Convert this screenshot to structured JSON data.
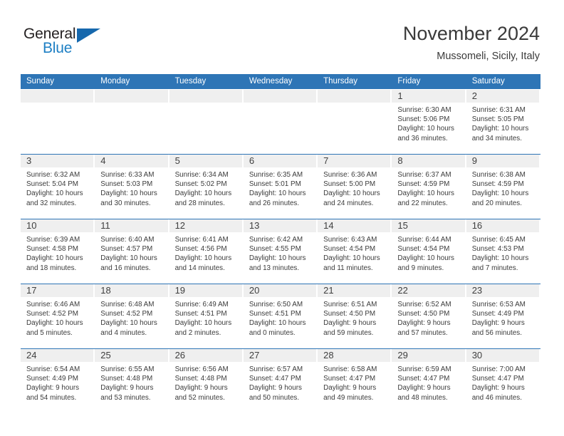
{
  "brand": {
    "name_part1": "General",
    "name_part2": "Blue",
    "accent_color": "#1668ad",
    "text_color": "#231f20"
  },
  "header": {
    "title": "November 2024",
    "location": "Mussomeli, Sicily, Italy"
  },
  "theme": {
    "header_blue": "#2e75b6",
    "daynum_band": "#efefef",
    "text": "#3b3b3b"
  },
  "weekdays": [
    "Sunday",
    "Monday",
    "Tuesday",
    "Wednesday",
    "Thursday",
    "Friday",
    "Saturday"
  ],
  "weeks": [
    [
      {
        "day": "",
        "empty": true
      },
      {
        "day": "",
        "empty": true
      },
      {
        "day": "",
        "empty": true
      },
      {
        "day": "",
        "empty": true
      },
      {
        "day": "",
        "empty": true
      },
      {
        "day": "1",
        "sunrise": "Sunrise: 6:30 AM",
        "sunset": "Sunset: 5:06 PM",
        "daylight1": "Daylight: 10 hours",
        "daylight2": "and 36 minutes."
      },
      {
        "day": "2",
        "sunrise": "Sunrise: 6:31 AM",
        "sunset": "Sunset: 5:05 PM",
        "daylight1": "Daylight: 10 hours",
        "daylight2": "and 34 minutes."
      }
    ],
    [
      {
        "day": "3",
        "sunrise": "Sunrise: 6:32 AM",
        "sunset": "Sunset: 5:04 PM",
        "daylight1": "Daylight: 10 hours",
        "daylight2": "and 32 minutes."
      },
      {
        "day": "4",
        "sunrise": "Sunrise: 6:33 AM",
        "sunset": "Sunset: 5:03 PM",
        "daylight1": "Daylight: 10 hours",
        "daylight2": "and 30 minutes."
      },
      {
        "day": "5",
        "sunrise": "Sunrise: 6:34 AM",
        "sunset": "Sunset: 5:02 PM",
        "daylight1": "Daylight: 10 hours",
        "daylight2": "and 28 minutes."
      },
      {
        "day": "6",
        "sunrise": "Sunrise: 6:35 AM",
        "sunset": "Sunset: 5:01 PM",
        "daylight1": "Daylight: 10 hours",
        "daylight2": "and 26 minutes."
      },
      {
        "day": "7",
        "sunrise": "Sunrise: 6:36 AM",
        "sunset": "Sunset: 5:00 PM",
        "daylight1": "Daylight: 10 hours",
        "daylight2": "and 24 minutes."
      },
      {
        "day": "8",
        "sunrise": "Sunrise: 6:37 AM",
        "sunset": "Sunset: 4:59 PM",
        "daylight1": "Daylight: 10 hours",
        "daylight2": "and 22 minutes."
      },
      {
        "day": "9",
        "sunrise": "Sunrise: 6:38 AM",
        "sunset": "Sunset: 4:59 PM",
        "daylight1": "Daylight: 10 hours",
        "daylight2": "and 20 minutes."
      }
    ],
    [
      {
        "day": "10",
        "sunrise": "Sunrise: 6:39 AM",
        "sunset": "Sunset: 4:58 PM",
        "daylight1": "Daylight: 10 hours",
        "daylight2": "and 18 minutes."
      },
      {
        "day": "11",
        "sunrise": "Sunrise: 6:40 AM",
        "sunset": "Sunset: 4:57 PM",
        "daylight1": "Daylight: 10 hours",
        "daylight2": "and 16 minutes."
      },
      {
        "day": "12",
        "sunrise": "Sunrise: 6:41 AM",
        "sunset": "Sunset: 4:56 PM",
        "daylight1": "Daylight: 10 hours",
        "daylight2": "and 14 minutes."
      },
      {
        "day": "13",
        "sunrise": "Sunrise: 6:42 AM",
        "sunset": "Sunset: 4:55 PM",
        "daylight1": "Daylight: 10 hours",
        "daylight2": "and 13 minutes."
      },
      {
        "day": "14",
        "sunrise": "Sunrise: 6:43 AM",
        "sunset": "Sunset: 4:54 PM",
        "daylight1": "Daylight: 10 hours",
        "daylight2": "and 11 minutes."
      },
      {
        "day": "15",
        "sunrise": "Sunrise: 6:44 AM",
        "sunset": "Sunset: 4:54 PM",
        "daylight1": "Daylight: 10 hours",
        "daylight2": "and 9 minutes."
      },
      {
        "day": "16",
        "sunrise": "Sunrise: 6:45 AM",
        "sunset": "Sunset: 4:53 PM",
        "daylight1": "Daylight: 10 hours",
        "daylight2": "and 7 minutes."
      }
    ],
    [
      {
        "day": "17",
        "sunrise": "Sunrise: 6:46 AM",
        "sunset": "Sunset: 4:52 PM",
        "daylight1": "Daylight: 10 hours",
        "daylight2": "and 5 minutes."
      },
      {
        "day": "18",
        "sunrise": "Sunrise: 6:48 AM",
        "sunset": "Sunset: 4:52 PM",
        "daylight1": "Daylight: 10 hours",
        "daylight2": "and 4 minutes."
      },
      {
        "day": "19",
        "sunrise": "Sunrise: 6:49 AM",
        "sunset": "Sunset: 4:51 PM",
        "daylight1": "Daylight: 10 hours",
        "daylight2": "and 2 minutes."
      },
      {
        "day": "20",
        "sunrise": "Sunrise: 6:50 AM",
        "sunset": "Sunset: 4:51 PM",
        "daylight1": "Daylight: 10 hours",
        "daylight2": "and 0 minutes."
      },
      {
        "day": "21",
        "sunrise": "Sunrise: 6:51 AM",
        "sunset": "Sunset: 4:50 PM",
        "daylight1": "Daylight: 9 hours",
        "daylight2": "and 59 minutes."
      },
      {
        "day": "22",
        "sunrise": "Sunrise: 6:52 AM",
        "sunset": "Sunset: 4:50 PM",
        "daylight1": "Daylight: 9 hours",
        "daylight2": "and 57 minutes."
      },
      {
        "day": "23",
        "sunrise": "Sunrise: 6:53 AM",
        "sunset": "Sunset: 4:49 PM",
        "daylight1": "Daylight: 9 hours",
        "daylight2": "and 56 minutes."
      }
    ],
    [
      {
        "day": "24",
        "sunrise": "Sunrise: 6:54 AM",
        "sunset": "Sunset: 4:49 PM",
        "daylight1": "Daylight: 9 hours",
        "daylight2": "and 54 minutes."
      },
      {
        "day": "25",
        "sunrise": "Sunrise: 6:55 AM",
        "sunset": "Sunset: 4:48 PM",
        "daylight1": "Daylight: 9 hours",
        "daylight2": "and 53 minutes."
      },
      {
        "day": "26",
        "sunrise": "Sunrise: 6:56 AM",
        "sunset": "Sunset: 4:48 PM",
        "daylight1": "Daylight: 9 hours",
        "daylight2": "and 52 minutes."
      },
      {
        "day": "27",
        "sunrise": "Sunrise: 6:57 AM",
        "sunset": "Sunset: 4:47 PM",
        "daylight1": "Daylight: 9 hours",
        "daylight2": "and 50 minutes."
      },
      {
        "day": "28",
        "sunrise": "Sunrise: 6:58 AM",
        "sunset": "Sunset: 4:47 PM",
        "daylight1": "Daylight: 9 hours",
        "daylight2": "and 49 minutes."
      },
      {
        "day": "29",
        "sunrise": "Sunrise: 6:59 AM",
        "sunset": "Sunset: 4:47 PM",
        "daylight1": "Daylight: 9 hours",
        "daylight2": "and 48 minutes."
      },
      {
        "day": "30",
        "sunrise": "Sunrise: 7:00 AM",
        "sunset": "Sunset: 4:47 PM",
        "daylight1": "Daylight: 9 hours",
        "daylight2": "and 46 minutes."
      }
    ]
  ]
}
